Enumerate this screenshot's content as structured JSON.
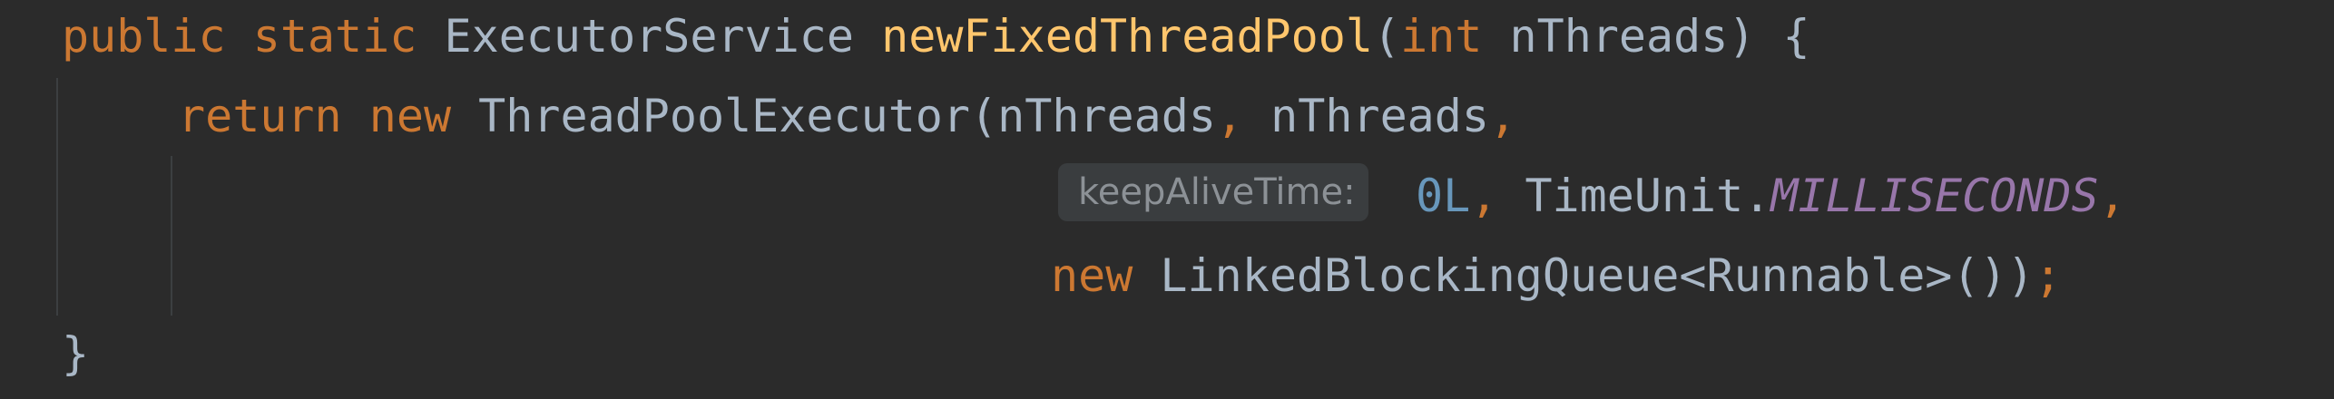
{
  "code": {
    "line1": {
      "public": "public",
      "static": "static",
      "return_type": "ExecutorService",
      "method_name": "newFixedThreadPool",
      "open_paren": "(",
      "param_type": "int",
      "param_name": "nThreads",
      "close": ") {"
    },
    "line2": {
      "return": "return",
      "new": "new",
      "class_name": "ThreadPoolExecutor",
      "args": "(nThreads",
      "comma1": ",",
      "arg2": "nThreads",
      "comma2": ","
    },
    "line3": {
      "hint": "keepAliveTime:",
      "zero": "0L",
      "comma1": ",",
      "enum_class": "TimeUnit.",
      "enum_const": "MILLISECONDS",
      "comma2": ","
    },
    "line4": {
      "new": "new",
      "queue_type": "LinkedBlockingQueue<Runnable>()",
      "close_paren": ")",
      "semicolon": ";"
    },
    "line5": {
      "close_brace": "}"
    }
  },
  "colors": {
    "background": "#2b2b2b",
    "keyword": "#cc7832",
    "method": "#ffc66d",
    "identifier": "#a9b7c6",
    "number": "#6897bb",
    "constant": "#9876aa",
    "hint_bg": "#3a3d3f",
    "hint_text": "#8c9196"
  }
}
